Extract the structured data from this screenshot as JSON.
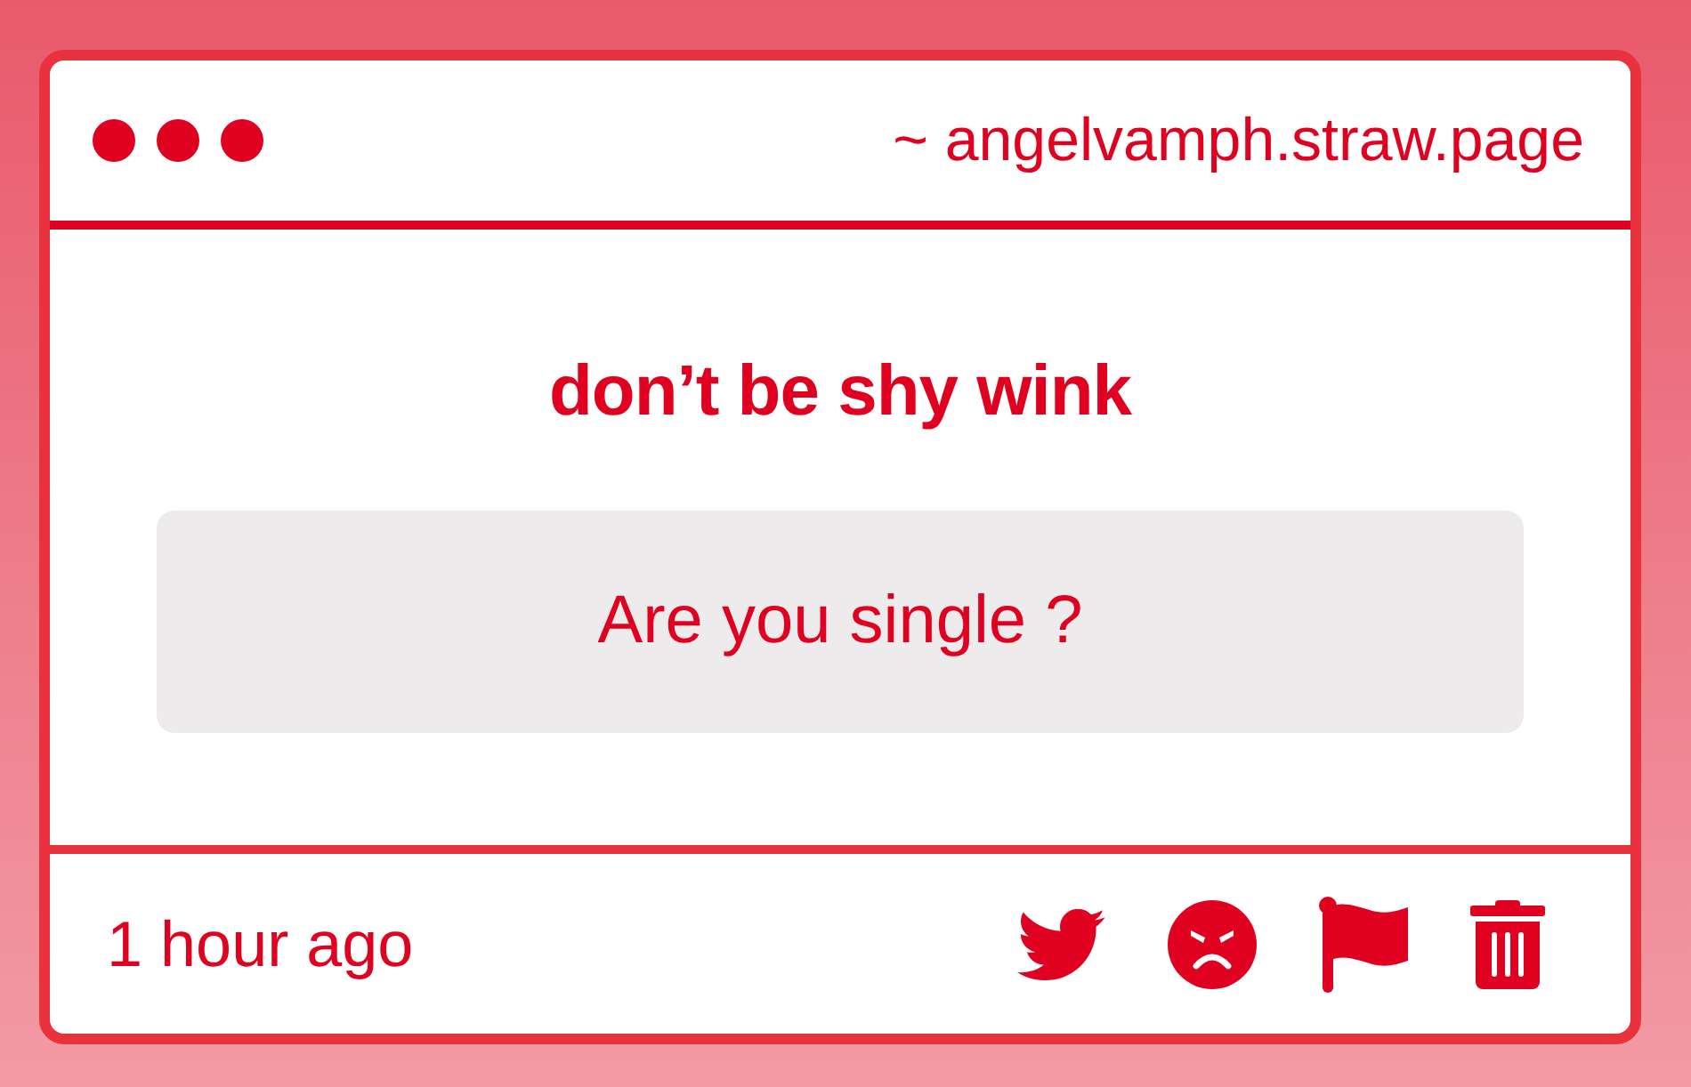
{
  "window": {
    "address": "~ angelvamph.straw.page"
  },
  "card": {
    "title": "don’t be shy wink",
    "message": "Are you single ?"
  },
  "footer": {
    "time": "1 hour ago",
    "actions": [
      {
        "kind": "tweet"
      },
      {
        "kind": "react"
      },
      {
        "kind": "report"
      },
      {
        "kind": "delete"
      }
    ]
  }
}
